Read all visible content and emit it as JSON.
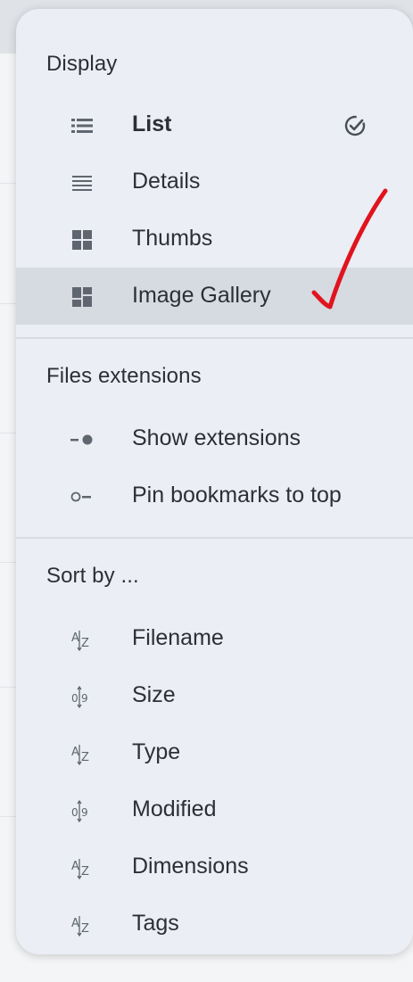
{
  "display": {
    "title": "Display",
    "items": [
      {
        "label": "List",
        "icon": "list-icon",
        "checked": true
      },
      {
        "label": "Details",
        "icon": "details-icon"
      },
      {
        "label": "Thumbs",
        "icon": "thumbs-icon"
      },
      {
        "label": "Image Gallery",
        "icon": "gallery-icon",
        "highlighted": true
      }
    ]
  },
  "files_extensions": {
    "title": "Files extensions",
    "items": [
      {
        "label": "Show extensions",
        "icon": "toggle-on-icon"
      },
      {
        "label": "Pin bookmarks to top",
        "icon": "toggle-off-icon"
      }
    ]
  },
  "sort_by": {
    "title": "Sort by ...",
    "items": [
      {
        "label": "Filename",
        "icon": "sort-alpha-icon"
      },
      {
        "label": "Size",
        "icon": "sort-numeric-icon"
      },
      {
        "label": "Type",
        "icon": "sort-alpha-icon"
      },
      {
        "label": "Modified",
        "icon": "sort-numeric-icon"
      },
      {
        "label": "Dimensions",
        "icon": "sort-alpha-icon"
      },
      {
        "label": "Tags",
        "icon": "sort-alpha-icon"
      }
    ]
  },
  "colors": {
    "menu_bg": "#ebeef4",
    "selected_bg": "#d6dae1",
    "text": "#2c3036",
    "icon": "#5f6670",
    "annotation": "#e0141e"
  }
}
